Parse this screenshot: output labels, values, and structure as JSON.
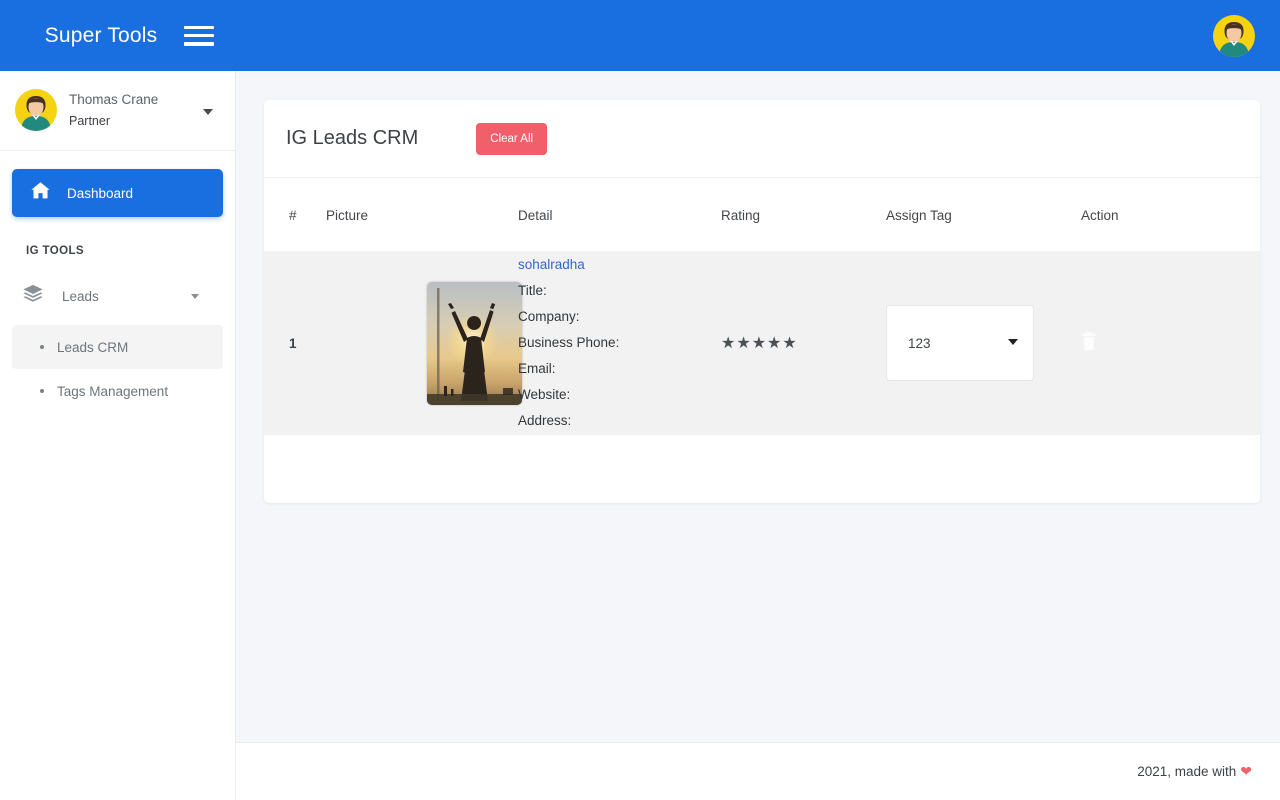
{
  "topbar": {
    "brand": "Super Tools",
    "menu_toggle_label": "☰",
    "accent_color": "#1a6fe0"
  },
  "sidebar": {
    "profile": {
      "name": "Thomas Crane",
      "role": "Partner"
    },
    "active_item": {
      "label": "Dashboard",
      "icon": "home-icon"
    },
    "section_title": "IG TOOLS",
    "group": {
      "label": "Leads",
      "icon": "layers-icon"
    },
    "subitems": [
      {
        "label": "Leads CRM",
        "selected": true
      },
      {
        "label": "Tags Management",
        "selected": false
      }
    ]
  },
  "card": {
    "title": "IG Leads CRM",
    "clear_all_label": "Clear All",
    "table": {
      "columns": [
        "#",
        "Picture",
        "Detail",
        "Rating",
        "Assign Tag",
        "Action"
      ],
      "rows": [
        {
          "index": "1",
          "picture_alt": "sunset-silhouette-arms-raised",
          "detail": {
            "handle": "sohalradha",
            "title": "Title:",
            "company": "Company:",
            "business_phone": "Business Phone:",
            "email": "Email:",
            "website": "Website:",
            "address": "Address:"
          },
          "rating": "★★★★★",
          "rating_value": 5,
          "assign_tag_value": "123",
          "assign_tag_options": [
            "123"
          ],
          "action_icon": "trash-icon"
        }
      ]
    }
  },
  "footer": {
    "text": "2021, made with",
    "heart": "❤",
    "heart_color": "#f1606a"
  }
}
